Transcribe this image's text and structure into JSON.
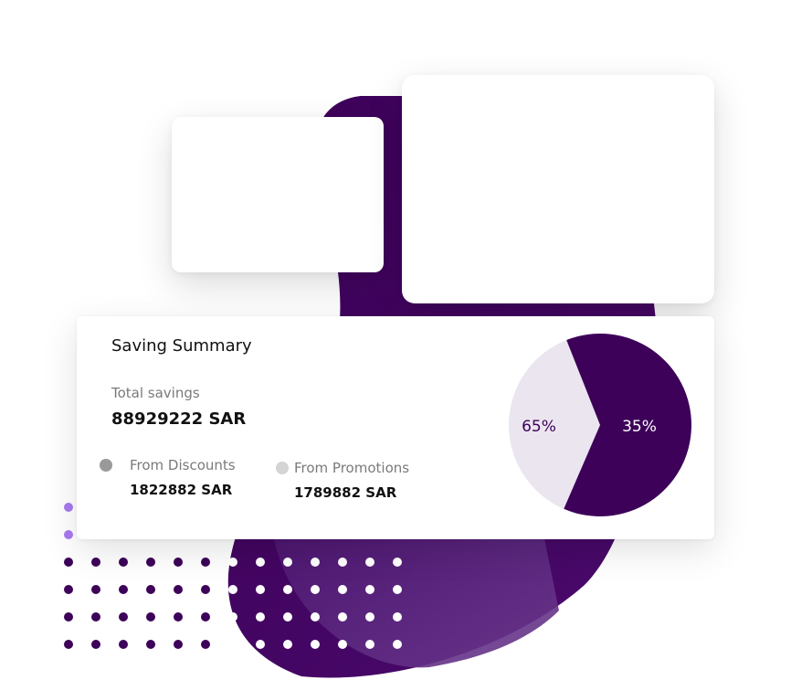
{
  "colors": {
    "primary_purple": "#3d0159",
    "light_purple_segment": "#ebe5ef",
    "accent_dot_purple": "#a879f0",
    "discount_dot": "#999999",
    "promotion_dot": "#d4d4d4"
  },
  "summary": {
    "title": "Saving Summary",
    "total_label": "Total savings",
    "total_value": "88929222 SAR",
    "discounts": {
      "label": "From Discounts",
      "value": "1822882 SAR"
    },
    "promotions": {
      "label": "From Promotions",
      "value": "1789882 SAR"
    }
  },
  "chart_data": {
    "type": "pie",
    "slices": [
      {
        "label": "65%",
        "value": 65
      },
      {
        "label": "35%",
        "value": 35
      }
    ]
  }
}
